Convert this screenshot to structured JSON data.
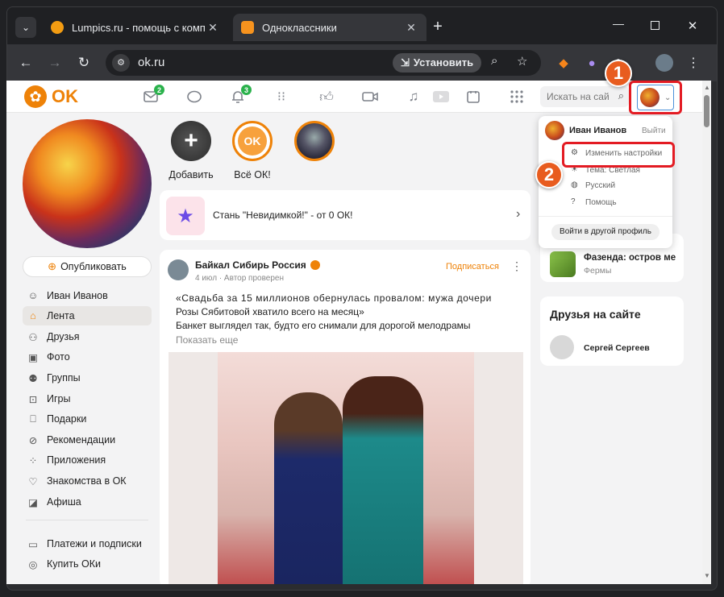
{
  "browser": {
    "tabs": [
      {
        "title": "Lumpics.ru - помощь с компь",
        "favicon_color": "#f39c12"
      },
      {
        "title": "Одноклассники",
        "favicon_color": "#f7931e"
      }
    ],
    "url": "ok.ru",
    "install_label": "Установить"
  },
  "header": {
    "logo_text": "OK",
    "messages_badge": "2",
    "notifications_badge": "3",
    "search_placeholder": "Искать на сай"
  },
  "stories": [
    {
      "label": "Добавить"
    },
    {
      "label": "Всё ОК!"
    }
  ],
  "promo": {
    "text": "Стань \"Невидимкой!\" - от 0 ОК!"
  },
  "sidebar": {
    "publish_label": "Опубликовать",
    "items": [
      {
        "label": "Иван Иванов",
        "icon": "user-icon"
      },
      {
        "label": "Лента",
        "icon": "home-icon"
      },
      {
        "label": "Друзья",
        "icon": "friends-icon"
      },
      {
        "label": "Фото",
        "icon": "photo-icon"
      },
      {
        "label": "Группы",
        "icon": "groups-icon"
      },
      {
        "label": "Игры",
        "icon": "gamepad-icon"
      },
      {
        "label": "Подарки",
        "icon": "gift-icon"
      },
      {
        "label": "Рекомендации",
        "icon": "compass-icon"
      },
      {
        "label": "Приложения",
        "icon": "apps-icon"
      },
      {
        "label": "Знакомства в ОК",
        "icon": "heart-icon"
      },
      {
        "label": "Афиша",
        "icon": "ticket-icon"
      },
      {
        "label": "Платежи и подписки",
        "icon": "wallet-icon"
      },
      {
        "label": "Купить ОКи",
        "icon": "coin-icon"
      }
    ]
  },
  "post": {
    "group_name": "Байкал Сибирь Россия",
    "meta": "4 июл · Автор проверен",
    "subscribe_label": "Подписаться",
    "line1": "«Свадьба за 15 миллионов обернулась провалом: мужа дочери",
    "line2": "Розы Сябитовой хватило всего на месяц»",
    "line3": "Банкет выглядел так, будто его снимали для дорогой мелодрамы",
    "show_more": "Показать еще"
  },
  "right": {
    "game_title": "Фазенда: остров ме",
    "game_sub": "Фермы",
    "friends_title": "Друзья на сайте",
    "friend_name": "Сергей Сергеев"
  },
  "menu": {
    "user_name": "Иван Иванов",
    "logout": "Выйти",
    "settings": "Изменить настройки",
    "theme": "Тема: Светлая",
    "language": "Русский",
    "help": "Помощь",
    "other_profile": "Войти в другой профиль"
  },
  "callouts": [
    "1",
    "2"
  ],
  "colors": {
    "accent": "#ee8208",
    "annotation": "#e31b23"
  }
}
